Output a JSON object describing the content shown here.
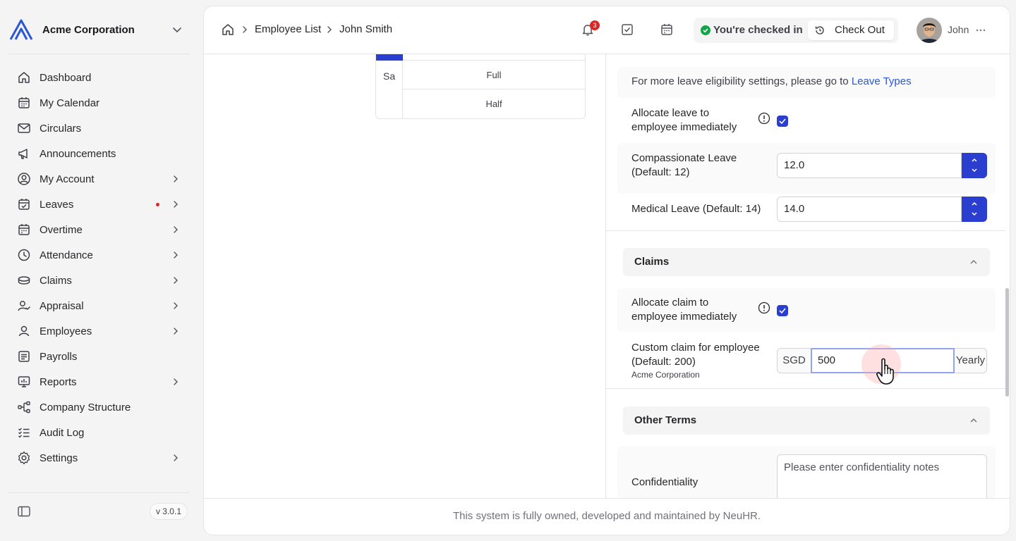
{
  "sidebar": {
    "org_name": "Acme Corporation",
    "logo_icon": "acme-logo",
    "items": [
      {
        "label": "Dashboard",
        "icon": "home-icon"
      },
      {
        "label": "My Calendar",
        "icon": "calendar-icon"
      },
      {
        "label": "Circulars",
        "icon": "mail-icon"
      },
      {
        "label": "Announcements",
        "icon": "megaphone-icon"
      },
      {
        "label": "My Account",
        "icon": "user-circle-icon",
        "has_children": true
      },
      {
        "label": "Leaves",
        "icon": "calendar-check-icon",
        "has_children": true,
        "has_dot": true
      },
      {
        "label": "Overtime",
        "icon": "calendar-clock-icon",
        "has_children": true
      },
      {
        "label": "Attendance",
        "icon": "clock-icon",
        "has_children": true
      },
      {
        "label": "Claims",
        "icon": "coins-icon",
        "has_children": true
      },
      {
        "label": "Appraisal",
        "icon": "user-check-icon",
        "has_children": true
      },
      {
        "label": "Employees",
        "icon": "user-icon",
        "has_children": true
      },
      {
        "label": "Payrolls",
        "icon": "receipt-icon"
      },
      {
        "label": "Reports",
        "icon": "presentation-chart-icon",
        "has_children": true
      },
      {
        "label": "Company Structure",
        "icon": "network-icon"
      },
      {
        "label": "Audit Log",
        "icon": "list-check-icon"
      },
      {
        "label": "Settings",
        "icon": "gear-icon",
        "has_children": true
      }
    ],
    "version": "v 3.0.1"
  },
  "header": {
    "breadcrumb": [
      "Employee List",
      "John Smith"
    ],
    "notification_count": "3",
    "checkin_status": "You're checked in",
    "checkout_label": "Check Out",
    "user_name": "John"
  },
  "schedule": {
    "day": "Sa",
    "rows": [
      "Full",
      "Half"
    ]
  },
  "leave_settings": {
    "info_text": "For more leave eligibility settings, please go to ",
    "info_link": "Leave Types",
    "allocate_label_1": "Allocate leave to",
    "allocate_label_2": "employee immediately",
    "allocate_checked": true,
    "compassionate_label_1": "Compassionate Leave",
    "compassionate_label_2": "(Default: 12)",
    "compassionate_value": "12.0",
    "medical_label": "Medical Leave (Default: 14)",
    "medical_value": "14.0"
  },
  "claims": {
    "section_title": "Claims",
    "allocate_label_1": "Allocate claim to",
    "allocate_label_2": "employee immediately",
    "allocate_checked": true,
    "custom_label_1": "Custom claim for employee",
    "custom_label_2": "(Default: 200)",
    "custom_sub": "Acme Corporation",
    "currency": "SGD",
    "amount": "500",
    "period": "Yearly"
  },
  "other_terms": {
    "section_title": "Other Terms",
    "confidentiality_label": "Confidentiality",
    "confidentiality_placeholder": "Please enter confidentiality notes"
  },
  "footer": {
    "text": "This system is fully owned, developed and maintained by NeuHR."
  },
  "colors": {
    "accent": "#2a3fcf",
    "link": "#2a57d6",
    "success": "#16a34a",
    "alert": "#dc2626"
  }
}
